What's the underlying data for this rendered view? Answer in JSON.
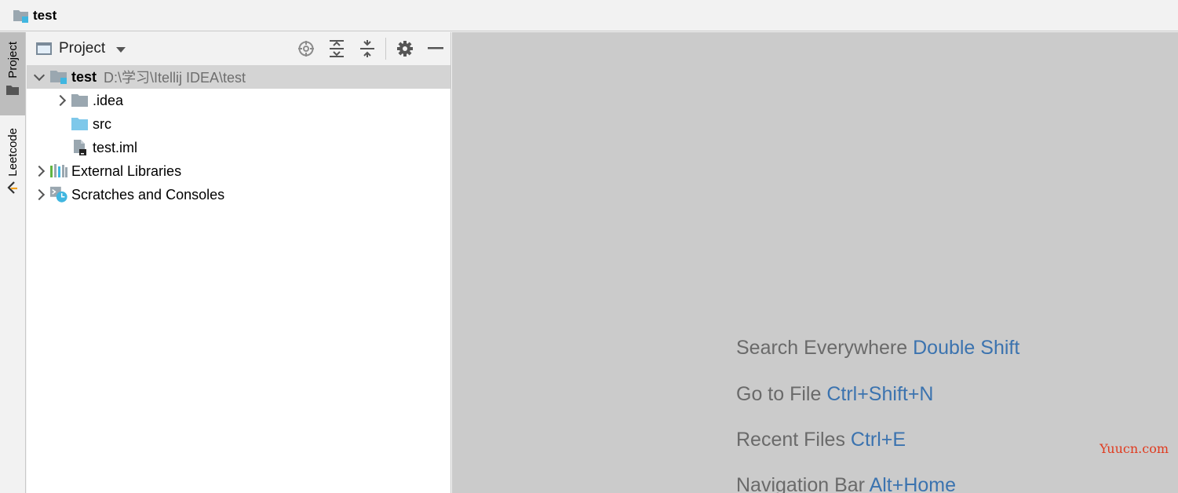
{
  "window": {
    "title": "test",
    "title_icon": "project-folder-icon"
  },
  "tool_stripe": {
    "items": [
      {
        "label": "Project",
        "icon": "folder-icon",
        "active": true
      },
      {
        "label": "Leetcode",
        "icon": "leetcode-icon",
        "active": false
      }
    ]
  },
  "project_panel": {
    "view_title": "Project",
    "toolbar": [
      {
        "name": "locate-icon"
      },
      {
        "name": "expand-all-icon"
      },
      {
        "name": "collapse-all-icon"
      },
      {
        "name": "gear-icon"
      },
      {
        "name": "hide-icon"
      }
    ],
    "tree": [
      {
        "label": "test",
        "path": "D:\\学习\\Itellij IDEA\\test",
        "icon": "module-folder-icon",
        "expanded": true,
        "selected": true
      },
      {
        "label": ".idea",
        "icon": "folder-icon",
        "expanded": false
      },
      {
        "label": "src",
        "icon": "source-folder-icon"
      },
      {
        "label": "test.iml",
        "icon": "iml-file-icon"
      },
      {
        "label": "External Libraries",
        "icon": "libraries-icon",
        "expanded": false
      },
      {
        "label": "Scratches and Consoles",
        "icon": "scratches-icon",
        "expanded": false
      }
    ]
  },
  "editor": {
    "hints": [
      {
        "text": "Search Everywhere",
        "key": "Double Shift"
      },
      {
        "text": "Go to File",
        "key": "Ctrl+Shift+N"
      },
      {
        "text": "Recent Files",
        "key": "Ctrl+E"
      },
      {
        "text": "Navigation Bar",
        "key": "Alt+Home"
      }
    ]
  },
  "watermark": "Yuucn.com",
  "colors": {
    "accent_blue": "#3b73af",
    "folder_gray": "#9aa7b0",
    "source_folder_blue": "#7ec8ea",
    "module_badge": "#40b6e0"
  }
}
